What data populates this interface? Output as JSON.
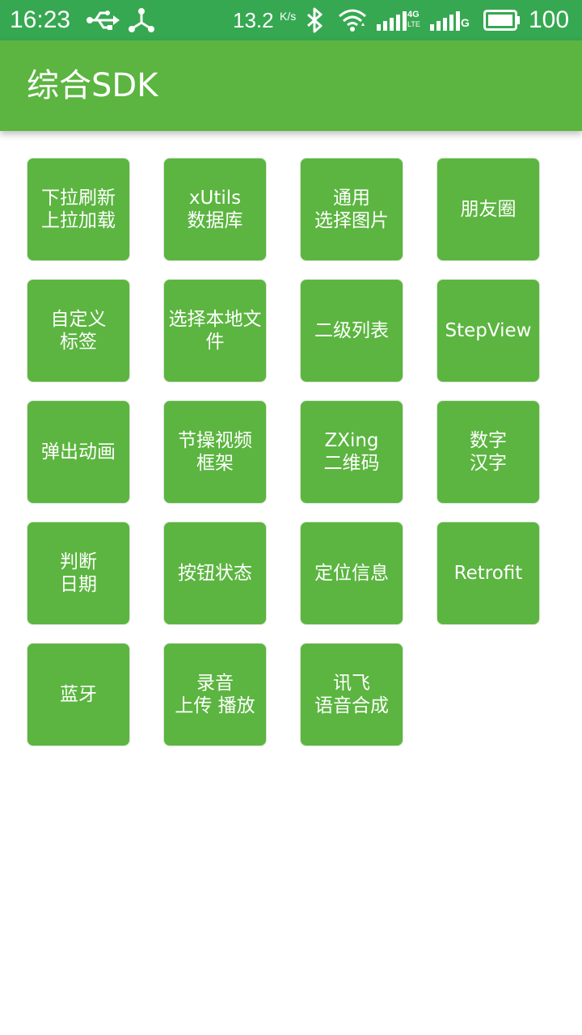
{
  "status_bar": {
    "time": "16:23",
    "speed": "13.2",
    "speed_unit": "K/s",
    "lte_label": "4G",
    "lte_sub": "LTE",
    "g_label": "G",
    "battery": "100",
    "color": "#36a851"
  },
  "app_bar": {
    "title": "综合SDK",
    "color": "#5bb540"
  },
  "tiles": [
    {
      "label": "下拉刷新\n上拉加载"
    },
    {
      "label": "xUtils\n数据库"
    },
    {
      "label": "通用\n选择图片"
    },
    {
      "label": "朋友圈"
    },
    {
      "label": "自定义\n标签"
    },
    {
      "label": "选择本地文\n件"
    },
    {
      "label": "二级列表"
    },
    {
      "label": "StepView"
    },
    {
      "label": "弹出动画"
    },
    {
      "label": "节操视频\n框架"
    },
    {
      "label": "ZXing\n二维码"
    },
    {
      "label": "数字\n汉字"
    },
    {
      "label": "判断\n日期"
    },
    {
      "label": "按钮状态"
    },
    {
      "label": "定位信息"
    },
    {
      "label": "Retrofit"
    },
    {
      "label": "蓝牙"
    },
    {
      "label": "录音\n上传  播放"
    },
    {
      "label": "讯飞\n语音合成"
    }
  ]
}
